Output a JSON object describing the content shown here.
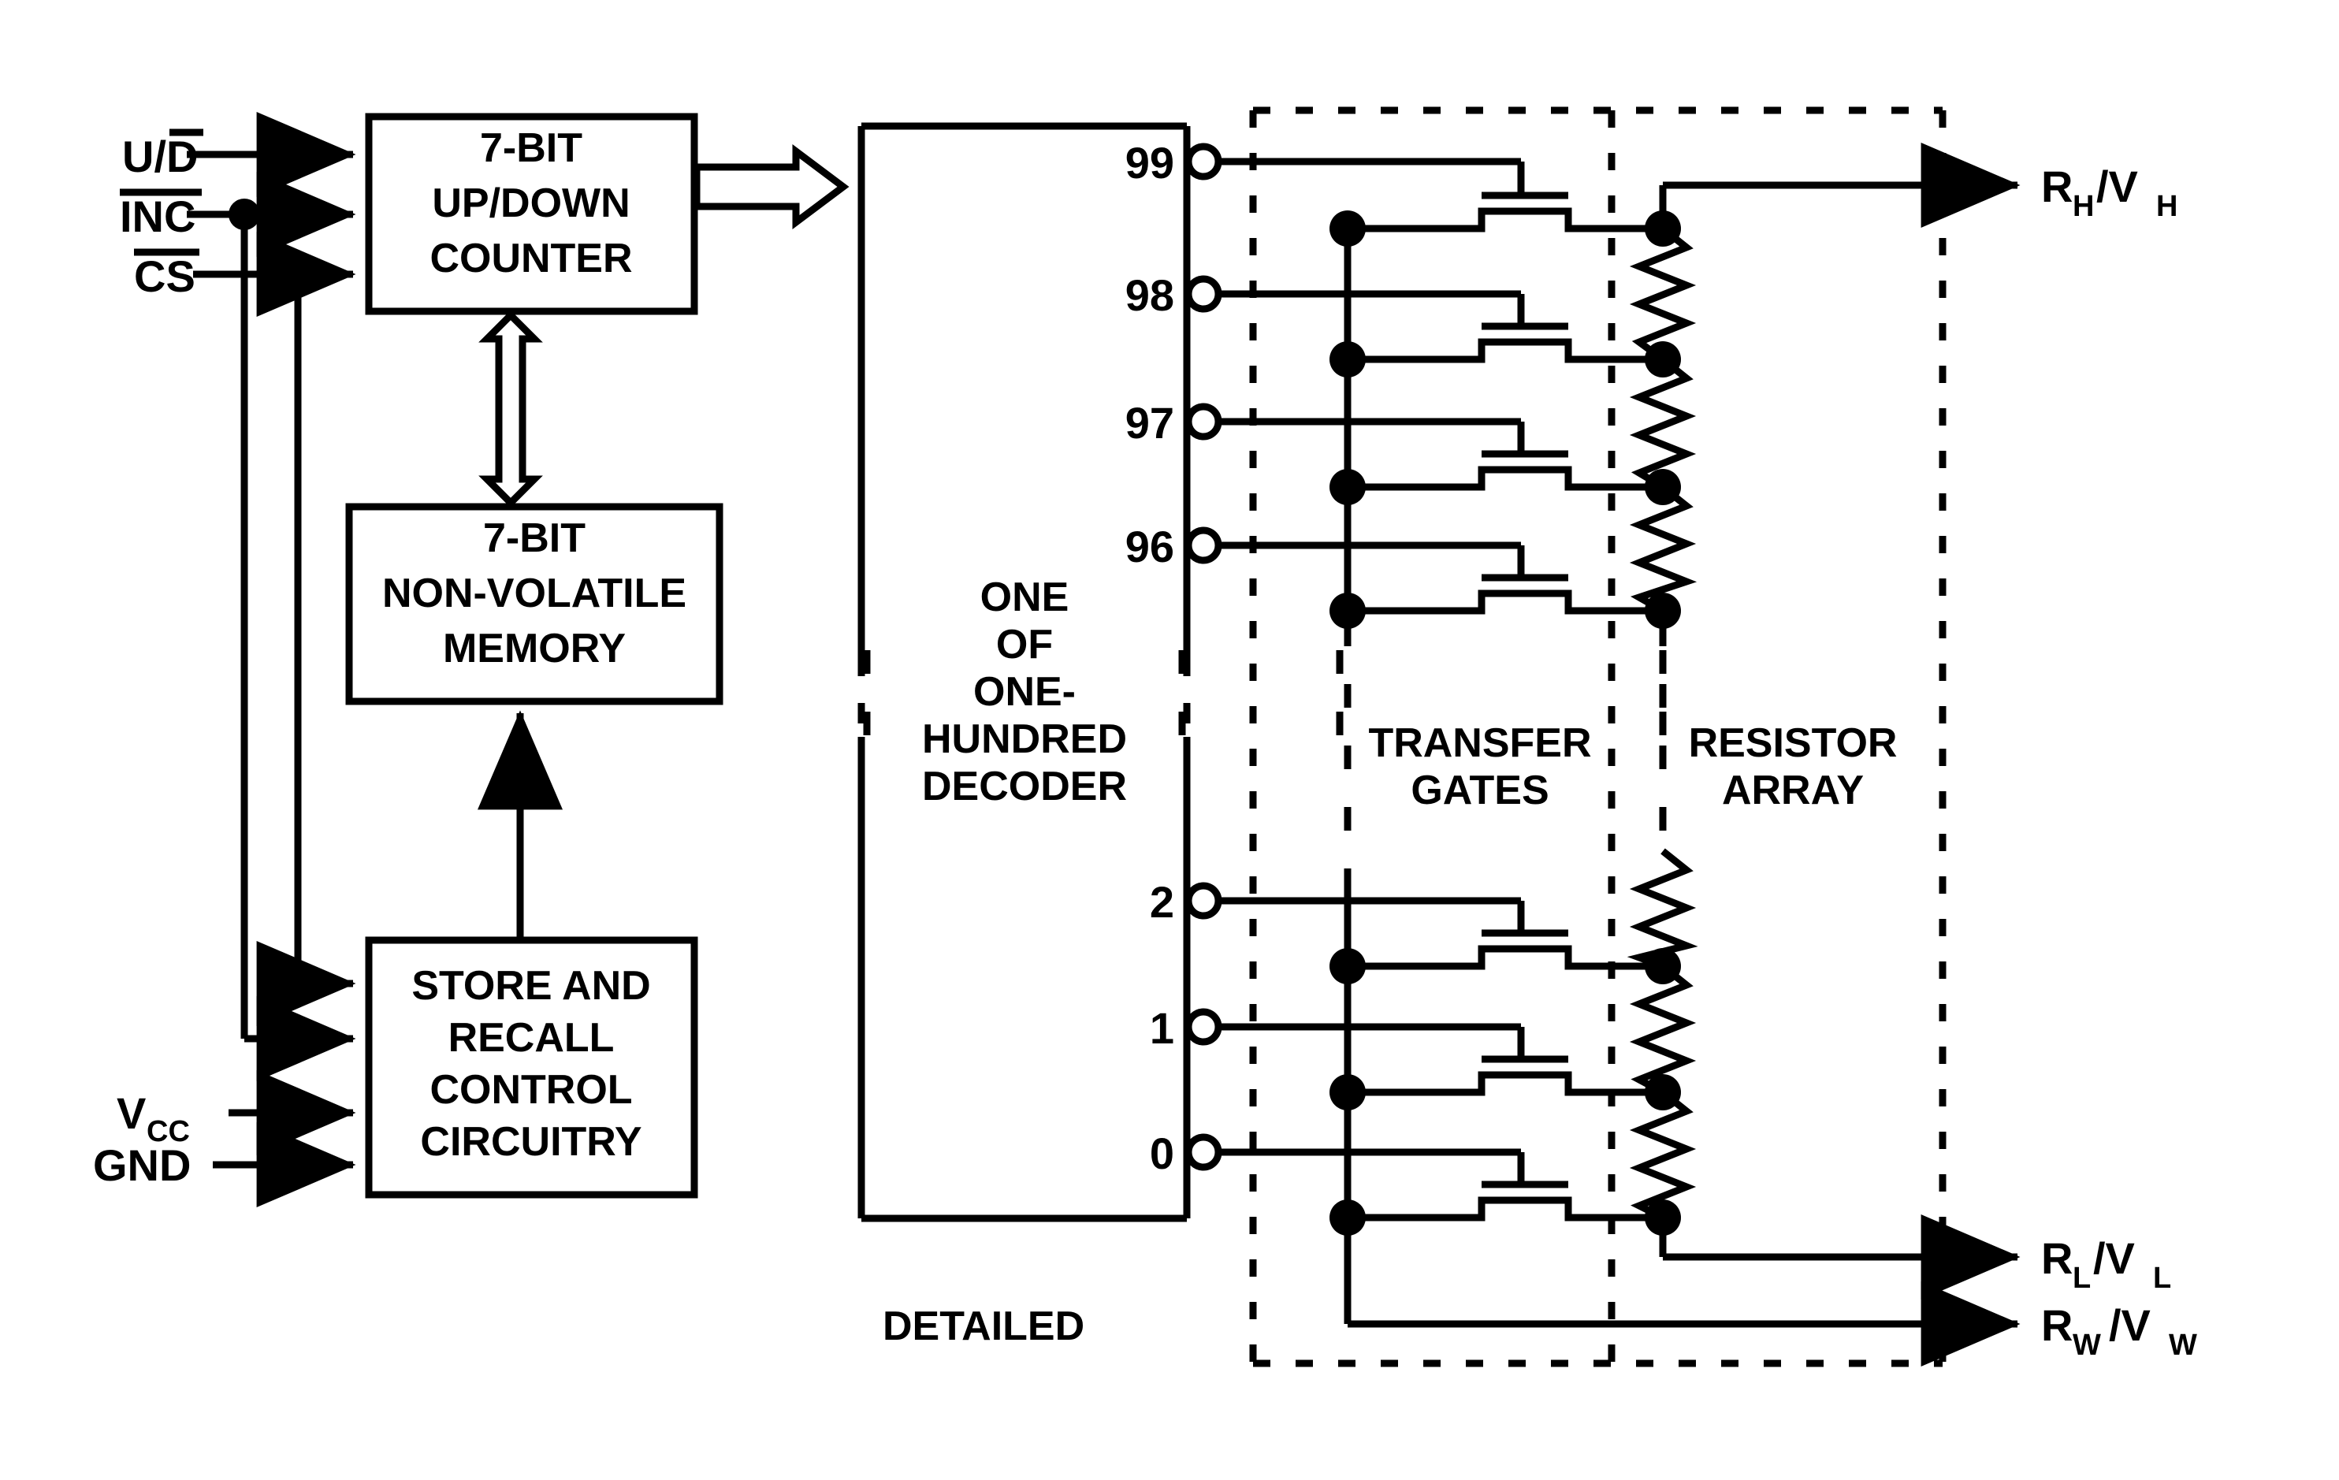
{
  "diagram": {
    "title": "DETAILED",
    "stroke_color": "#000000",
    "background_color": "#ffffff"
  },
  "inputs": [
    {
      "id": "ud",
      "base": "U/D",
      "overbar_part": "D",
      "label": "U/D̅",
      "bar_over": "partial"
    },
    {
      "id": "inc",
      "base": "INC",
      "overbar_part": "INC",
      "label": "I̅N̅C̅",
      "bar_over": "full"
    },
    {
      "id": "cs",
      "base": "CS",
      "overbar_part": "CS",
      "label": "C̅S̅",
      "bar_over": "full"
    },
    {
      "id": "vcc",
      "base": "V",
      "sub": "CC",
      "label": "VCC",
      "bar_over": "none"
    },
    {
      "id": "gnd",
      "base": "GND",
      "sub": "",
      "label": "GND",
      "bar_over": "none"
    }
  ],
  "blocks": [
    {
      "id": "counter",
      "lines": [
        "7-BIT",
        "UP/DOWN",
        "COUNTER"
      ]
    },
    {
      "id": "nvmem",
      "lines": [
        "7-BIT",
        "NON-VOLATILE",
        "MEMORY"
      ]
    },
    {
      "id": "control",
      "lines": [
        "STORE AND",
        "RECALL",
        "CONTROL",
        "CIRCUITRY"
      ]
    },
    {
      "id": "decoder",
      "lines": [
        "ONE",
        "OF",
        "ONE-",
        "HUNDRED",
        "DECODER"
      ]
    }
  ],
  "sections": [
    {
      "id": "transfer-gates",
      "lines": [
        "TRANSFER",
        "GATES"
      ]
    },
    {
      "id": "resistor-array",
      "lines": [
        "RESISTOR",
        "ARRAY"
      ]
    }
  ],
  "decoder_outputs_top": [
    "99",
    "98",
    "97",
    "96"
  ],
  "decoder_outputs_bottom": [
    "2",
    "1",
    "0"
  ],
  "outputs": [
    {
      "id": "rh",
      "r": "R",
      "rsub": "H",
      "v": "V",
      "vsub": "H",
      "label": "RH/VH"
    },
    {
      "id": "rl",
      "r": "R",
      "rsub": "L",
      "v": "V",
      "vsub": "L",
      "label": "RL/VL"
    },
    {
      "id": "rw",
      "r": "R",
      "rsub": "W",
      "v": "V",
      "vsub": "W",
      "label": "RW/VW"
    }
  ]
}
